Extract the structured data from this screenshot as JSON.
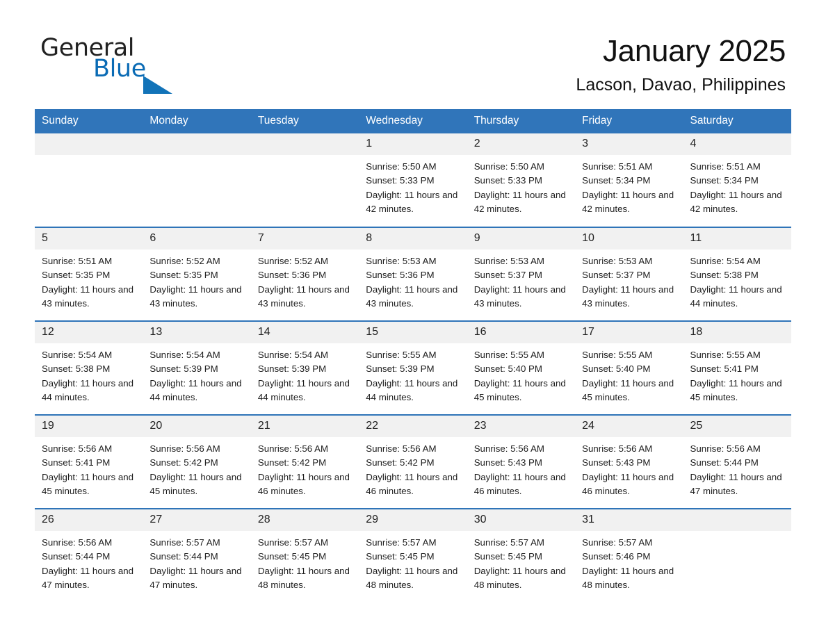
{
  "brand": {
    "name_part1": "General",
    "name_part2": "Blue",
    "triangle_color": "#1273b8",
    "blue_color": "#0a6bb5"
  },
  "header": {
    "month_title": "January 2025",
    "location": "Lacson, Davao, Philippines"
  },
  "calendar": {
    "header_bg": "#3075ba",
    "row_divider_color": "#2f74b8",
    "daynum_bg": "#f1f1f1",
    "weekdays": [
      "Sunday",
      "Monday",
      "Tuesday",
      "Wednesday",
      "Thursday",
      "Friday",
      "Saturday"
    ],
    "weeks": [
      [
        {
          "day": "",
          "blank": true
        },
        {
          "day": "",
          "blank": true
        },
        {
          "day": "",
          "blank": true
        },
        {
          "day": "1",
          "sunrise": "Sunrise: 5:50 AM",
          "sunset": "Sunset: 5:33 PM",
          "daylight": "Daylight: 11 hours and 42 minutes."
        },
        {
          "day": "2",
          "sunrise": "Sunrise: 5:50 AM",
          "sunset": "Sunset: 5:33 PM",
          "daylight": "Daylight: 11 hours and 42 minutes."
        },
        {
          "day": "3",
          "sunrise": "Sunrise: 5:51 AM",
          "sunset": "Sunset: 5:34 PM",
          "daylight": "Daylight: 11 hours and 42 minutes."
        },
        {
          "day": "4",
          "sunrise": "Sunrise: 5:51 AM",
          "sunset": "Sunset: 5:34 PM",
          "daylight": "Daylight: 11 hours and 42 minutes."
        }
      ],
      [
        {
          "day": "5",
          "sunrise": "Sunrise: 5:51 AM",
          "sunset": "Sunset: 5:35 PM",
          "daylight": "Daylight: 11 hours and 43 minutes."
        },
        {
          "day": "6",
          "sunrise": "Sunrise: 5:52 AM",
          "sunset": "Sunset: 5:35 PM",
          "daylight": "Daylight: 11 hours and 43 minutes."
        },
        {
          "day": "7",
          "sunrise": "Sunrise: 5:52 AM",
          "sunset": "Sunset: 5:36 PM",
          "daylight": "Daylight: 11 hours and 43 minutes."
        },
        {
          "day": "8",
          "sunrise": "Sunrise: 5:53 AM",
          "sunset": "Sunset: 5:36 PM",
          "daylight": "Daylight: 11 hours and 43 minutes."
        },
        {
          "day": "9",
          "sunrise": "Sunrise: 5:53 AM",
          "sunset": "Sunset: 5:37 PM",
          "daylight": "Daylight: 11 hours and 43 minutes."
        },
        {
          "day": "10",
          "sunrise": "Sunrise: 5:53 AM",
          "sunset": "Sunset: 5:37 PM",
          "daylight": "Daylight: 11 hours and 43 minutes."
        },
        {
          "day": "11",
          "sunrise": "Sunrise: 5:54 AM",
          "sunset": "Sunset: 5:38 PM",
          "daylight": "Daylight: 11 hours and 44 minutes."
        }
      ],
      [
        {
          "day": "12",
          "sunrise": "Sunrise: 5:54 AM",
          "sunset": "Sunset: 5:38 PM",
          "daylight": "Daylight: 11 hours and 44 minutes."
        },
        {
          "day": "13",
          "sunrise": "Sunrise: 5:54 AM",
          "sunset": "Sunset: 5:39 PM",
          "daylight": "Daylight: 11 hours and 44 minutes."
        },
        {
          "day": "14",
          "sunrise": "Sunrise: 5:54 AM",
          "sunset": "Sunset: 5:39 PM",
          "daylight": "Daylight: 11 hours and 44 minutes."
        },
        {
          "day": "15",
          "sunrise": "Sunrise: 5:55 AM",
          "sunset": "Sunset: 5:39 PM",
          "daylight": "Daylight: 11 hours and 44 minutes."
        },
        {
          "day": "16",
          "sunrise": "Sunrise: 5:55 AM",
          "sunset": "Sunset: 5:40 PM",
          "daylight": "Daylight: 11 hours and 45 minutes."
        },
        {
          "day": "17",
          "sunrise": "Sunrise: 5:55 AM",
          "sunset": "Sunset: 5:40 PM",
          "daylight": "Daylight: 11 hours and 45 minutes."
        },
        {
          "day": "18",
          "sunrise": "Sunrise: 5:55 AM",
          "sunset": "Sunset: 5:41 PM",
          "daylight": "Daylight: 11 hours and 45 minutes."
        }
      ],
      [
        {
          "day": "19",
          "sunrise": "Sunrise: 5:56 AM",
          "sunset": "Sunset: 5:41 PM",
          "daylight": "Daylight: 11 hours and 45 minutes."
        },
        {
          "day": "20",
          "sunrise": "Sunrise: 5:56 AM",
          "sunset": "Sunset: 5:42 PM",
          "daylight": "Daylight: 11 hours and 45 minutes."
        },
        {
          "day": "21",
          "sunrise": "Sunrise: 5:56 AM",
          "sunset": "Sunset: 5:42 PM",
          "daylight": "Daylight: 11 hours and 46 minutes."
        },
        {
          "day": "22",
          "sunrise": "Sunrise: 5:56 AM",
          "sunset": "Sunset: 5:42 PM",
          "daylight": "Daylight: 11 hours and 46 minutes."
        },
        {
          "day": "23",
          "sunrise": "Sunrise: 5:56 AM",
          "sunset": "Sunset: 5:43 PM",
          "daylight": "Daylight: 11 hours and 46 minutes."
        },
        {
          "day": "24",
          "sunrise": "Sunrise: 5:56 AM",
          "sunset": "Sunset: 5:43 PM",
          "daylight": "Daylight: 11 hours and 46 minutes."
        },
        {
          "day": "25",
          "sunrise": "Sunrise: 5:56 AM",
          "sunset": "Sunset: 5:44 PM",
          "daylight": "Daylight: 11 hours and 47 minutes."
        }
      ],
      [
        {
          "day": "26",
          "sunrise": "Sunrise: 5:56 AM",
          "sunset": "Sunset: 5:44 PM",
          "daylight": "Daylight: 11 hours and 47 minutes."
        },
        {
          "day": "27",
          "sunrise": "Sunrise: 5:57 AM",
          "sunset": "Sunset: 5:44 PM",
          "daylight": "Daylight: 11 hours and 47 minutes."
        },
        {
          "day": "28",
          "sunrise": "Sunrise: 5:57 AM",
          "sunset": "Sunset: 5:45 PM",
          "daylight": "Daylight: 11 hours and 48 minutes."
        },
        {
          "day": "29",
          "sunrise": "Sunrise: 5:57 AM",
          "sunset": "Sunset: 5:45 PM",
          "daylight": "Daylight: 11 hours and 48 minutes."
        },
        {
          "day": "30",
          "sunrise": "Sunrise: 5:57 AM",
          "sunset": "Sunset: 5:45 PM",
          "daylight": "Daylight: 11 hours and 48 minutes."
        },
        {
          "day": "31",
          "sunrise": "Sunrise: 5:57 AM",
          "sunset": "Sunset: 5:46 PM",
          "daylight": "Daylight: 11 hours and 48 minutes."
        },
        {
          "day": "",
          "blank": true
        }
      ]
    ]
  }
}
